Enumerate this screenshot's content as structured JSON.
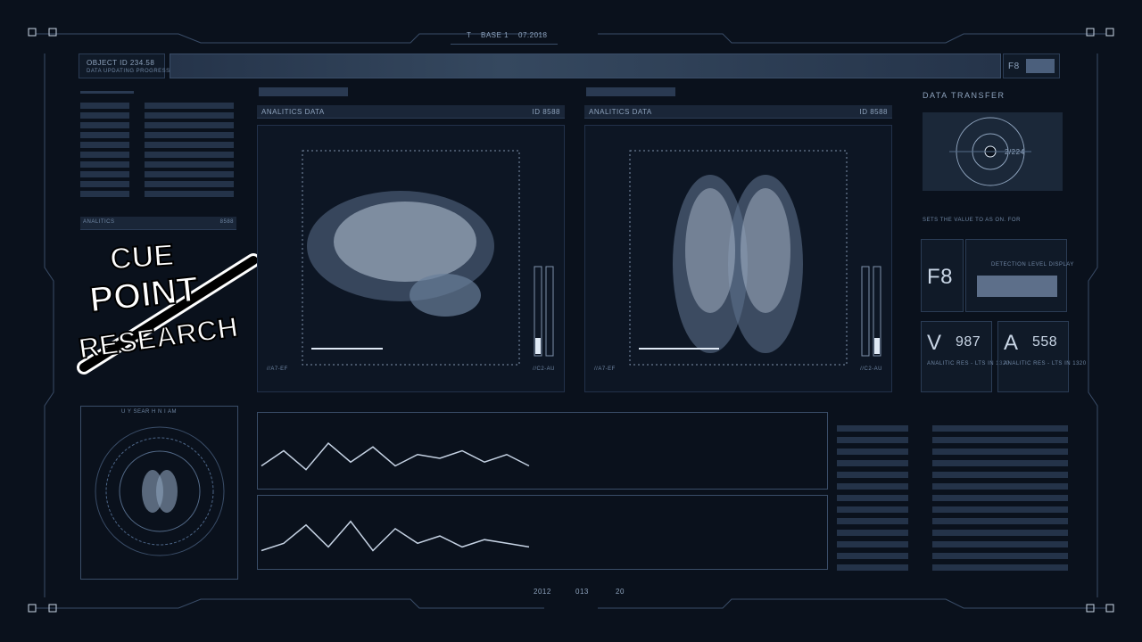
{
  "header": {
    "base_label": "BASE 1",
    "date": "07.2018",
    "t_label": "T",
    "object_id": "OBJECT ID 234.58",
    "object_sub": "DATA UPDATING PROGRESS",
    "f8_label": "F8"
  },
  "panels": {
    "left_panel": {
      "title": "ANALITICS",
      "number": "8588"
    },
    "center": {
      "title": "ANALITICS DATA",
      "id": "ID 8588",
      "code_left": "//A7-EF",
      "code_right": "//C2-AU"
    },
    "right": {
      "title": "ANALITICS DATA",
      "id": "ID 8588",
      "code_left": "//A7-EF",
      "code_right": "//C2-AU"
    }
  },
  "data_transfer": {
    "title": "DATA TRANSFER",
    "counter": "2/224",
    "note": "SETS THE VALUE TO AS ON. FOR",
    "f8_big": "F8",
    "detection": "DETECTION LEVEL DISPLAY",
    "v_letter": "V",
    "v_value": "987",
    "v_caption": "ANALITIC RES - LTS IN 1320",
    "a_letter": "A",
    "a_value": "558",
    "a_caption": "ANALITIC RES - LTS IN 1320"
  },
  "scan_panel": {
    "title": "U  Y SEAR  H N   I  AM"
  },
  "footer": {
    "items": [
      "2012",
      "013",
      "20"
    ]
  },
  "logo": {
    "line1": "CUE",
    "line2": "POINT",
    "line3": "RESEARCH"
  },
  "chart_data": [
    {
      "type": "line",
      "title": "",
      "series": [
        {
          "name": "",
          "values": [
            0.2,
            0.6,
            0.1,
            0.8,
            0.3,
            0.7,
            0.2,
            0.5,
            0.4,
            0.6,
            0.3,
            0.5,
            0.2
          ]
        }
      ]
    },
    {
      "type": "line",
      "title": "",
      "series": [
        {
          "name": "",
          "values": [
            0.1,
            0.3,
            0.8,
            0.2,
            0.9,
            0.1,
            0.7,
            0.3,
            0.5,
            0.2,
            0.4,
            0.3,
            0.2
          ]
        }
      ]
    }
  ],
  "colors": {
    "bg": "#0a111c",
    "panel": "#1a2638",
    "line": "#9fb4cc",
    "accent": "#dfe9f5"
  }
}
